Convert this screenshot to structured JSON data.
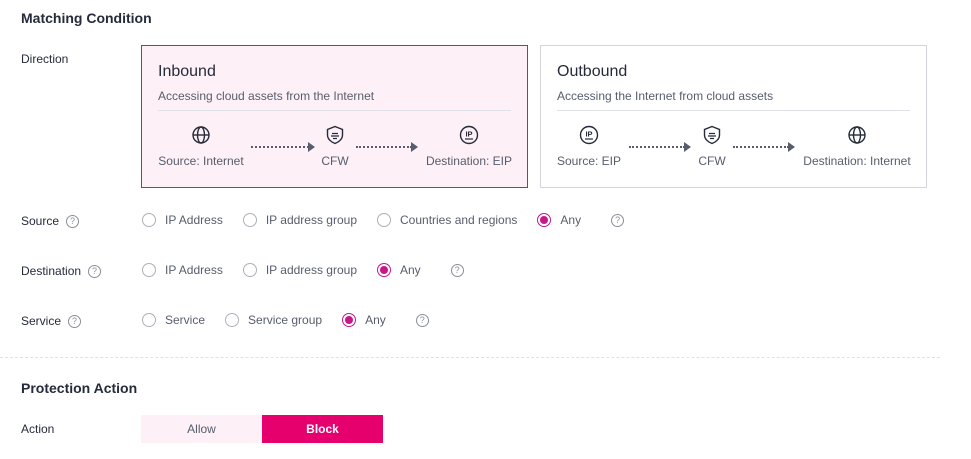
{
  "matching": {
    "title": "Matching Condition",
    "direction_label": "Direction",
    "inbound": {
      "title": "Inbound",
      "desc": "Accessing cloud assets from the Internet",
      "source": "Source: Internet",
      "middle": "CFW",
      "destination": "Destination: EIP",
      "selected": true
    },
    "outbound": {
      "title": "Outbound",
      "desc": "Accessing the Internet from cloud assets",
      "source": "Source: EIP",
      "middle": "CFW",
      "destination": "Destination: Internet",
      "selected": false
    }
  },
  "source": {
    "label": "Source",
    "options": [
      "IP Address",
      "IP address group",
      "Countries and regions",
      "Any"
    ],
    "selected": "Any"
  },
  "destination": {
    "label": "Destination",
    "options": [
      "IP Address",
      "IP address group",
      "Any"
    ],
    "selected": "Any"
  },
  "service": {
    "label": "Service",
    "options": [
      "Service",
      "Service group",
      "Any"
    ],
    "selected": "Any"
  },
  "protection": {
    "title": "Protection Action",
    "action_label": "Action",
    "allow": "Allow",
    "block": "Block",
    "selected": "Block"
  },
  "icons": {
    "help": "?",
    "eip": "IP"
  },
  "colors": {
    "accent": "#c7188a",
    "button_active": "#e6006e",
    "selected_bg": "#fdf0f6"
  }
}
